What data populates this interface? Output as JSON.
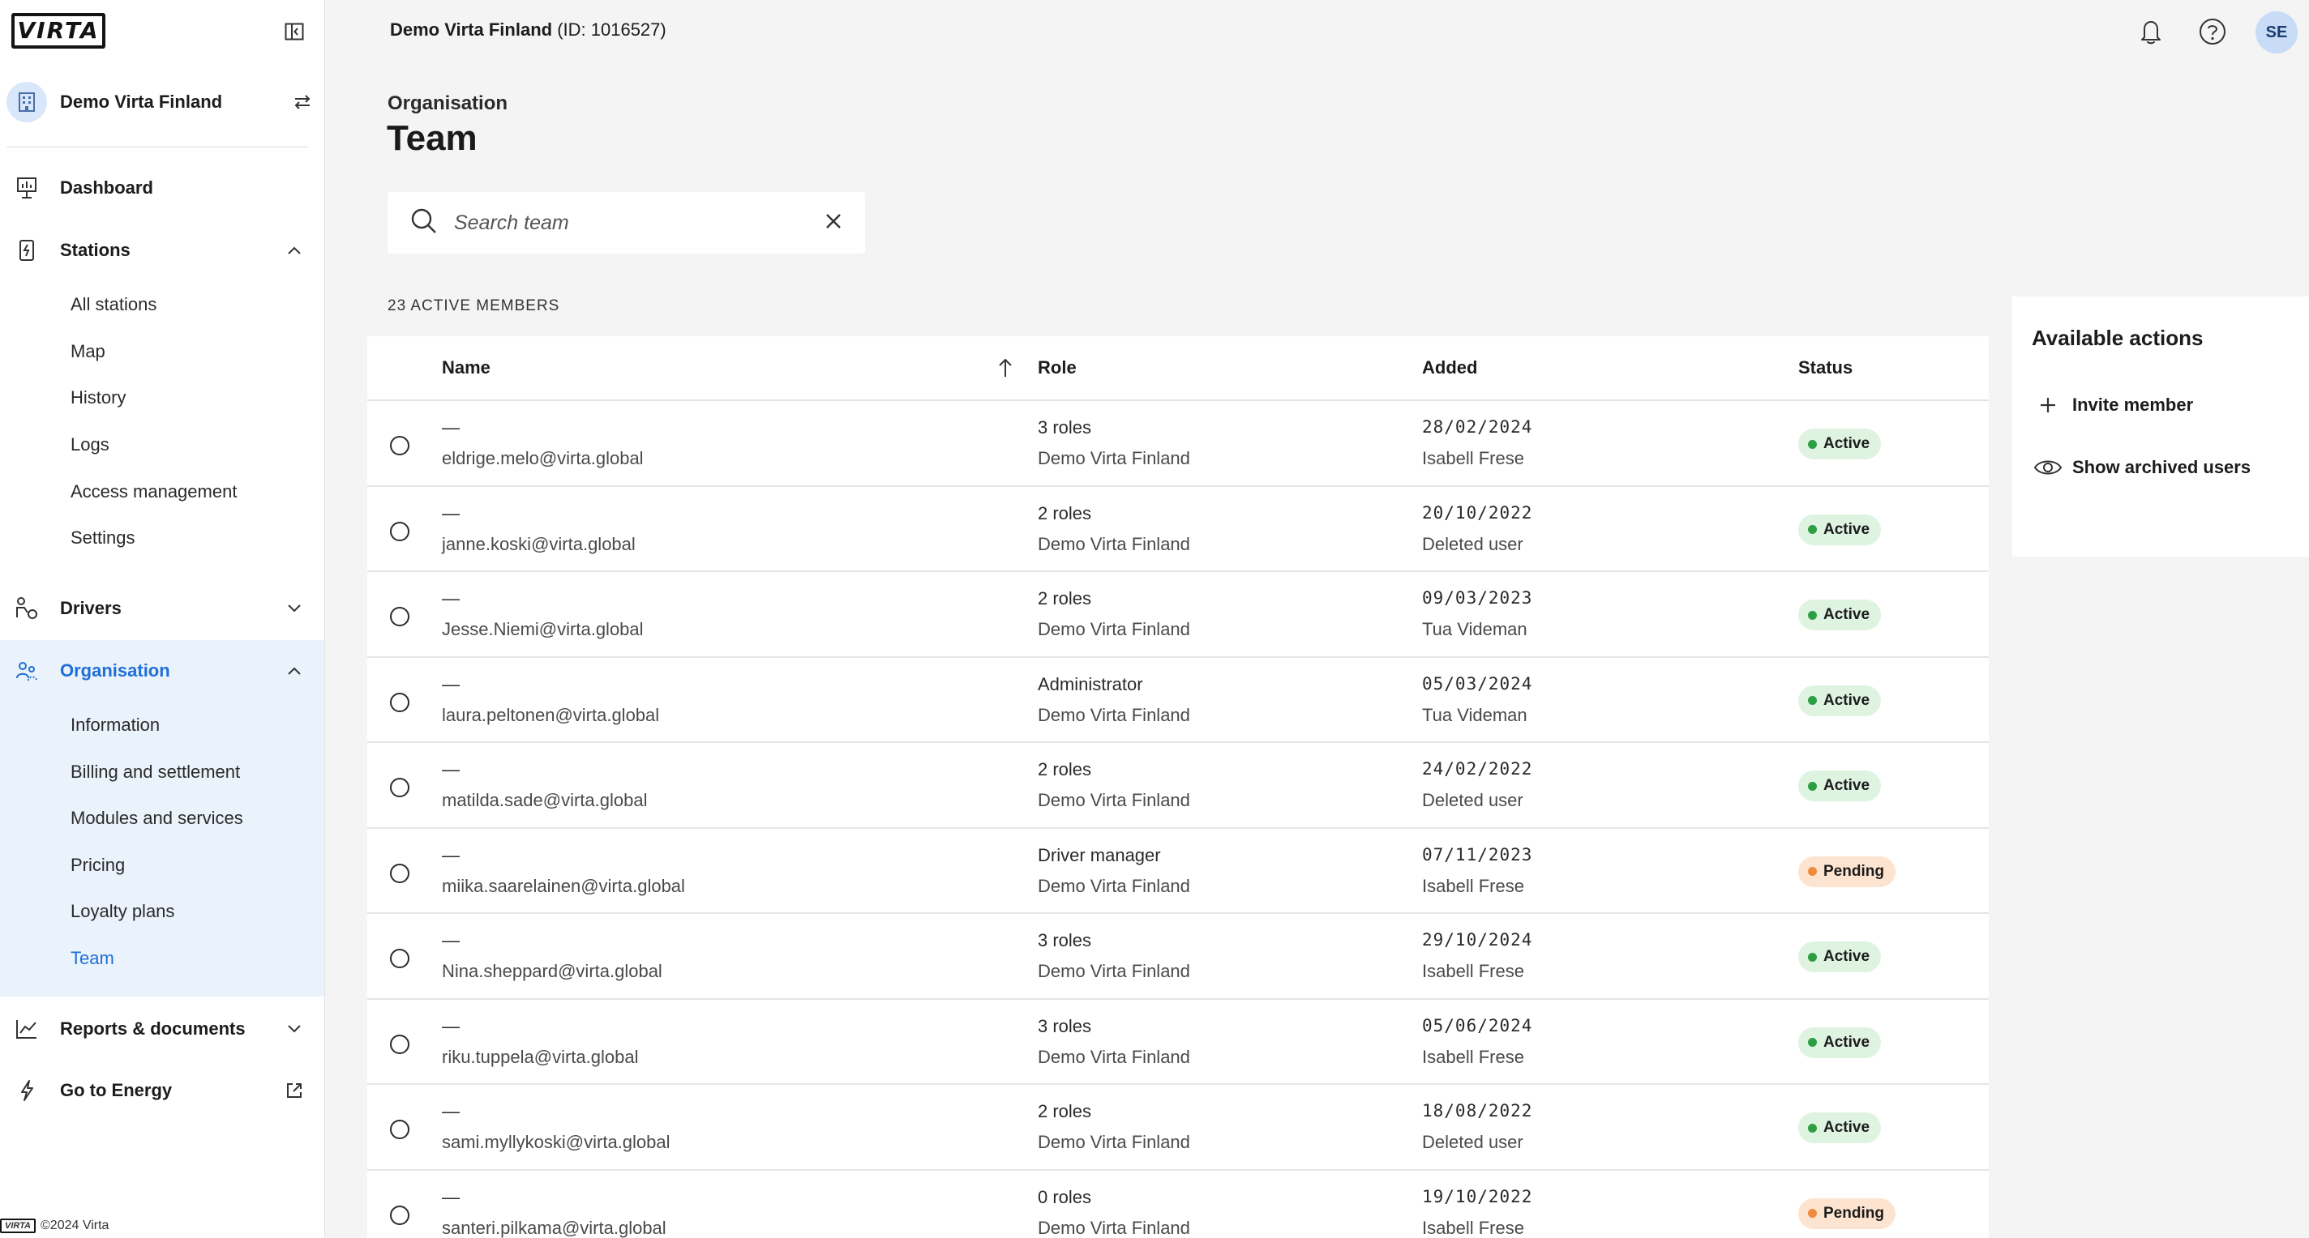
{
  "brand": {
    "logo_text": "VIRTA",
    "footer_logo_text": "VIRTA",
    "copyright": "©2024 Virta",
    "accent": "#1f6fd6"
  },
  "header": {
    "org_name": "Demo Virta Finland",
    "org_id": "(ID: 1016527)",
    "user_initials": "SE"
  },
  "sidebar": {
    "org_switcher": "Demo Virta Finland",
    "nav": {
      "dashboard": "Dashboard",
      "stations": "Stations",
      "stations_sub": [
        "All stations",
        "Map",
        "History",
        "Logs",
        "Access management",
        "Settings"
      ],
      "drivers": "Drivers",
      "organisation": "Organisation",
      "organisation_sub": [
        "Information",
        "Billing and settlement",
        "Modules and services",
        "Pricing",
        "Loyalty plans",
        "Team"
      ],
      "reports": "Reports & documents",
      "energy": "Go to Energy"
    }
  },
  "page": {
    "breadcrumb": "Organisation",
    "title": "Team",
    "search_placeholder": "Search team",
    "members_count": "23 ACTIVE MEMBERS"
  },
  "table": {
    "columns": {
      "name": "Name",
      "role": "Role",
      "added": "Added",
      "status": "Status"
    },
    "rows": [
      {
        "name": "—",
        "email": "eldrige.melo@virta.global",
        "role": "3 roles",
        "org": "Demo Virta Finland",
        "date": "28/02/2024",
        "added_by": "Isabell Frese",
        "status": "Active"
      },
      {
        "name": "—",
        "email": "janne.koski@virta.global",
        "role": "2 roles",
        "org": "Demo Virta Finland",
        "date": "20/10/2022",
        "added_by": "Deleted user",
        "status": "Active"
      },
      {
        "name": "—",
        "email": "Jesse.Niemi@virta.global",
        "role": "2 roles",
        "org": "Demo Virta Finland",
        "date": "09/03/2023",
        "added_by": "Tua Videman",
        "status": "Active"
      },
      {
        "name": "—",
        "email": "laura.peltonen@virta.global",
        "role": "Administrator",
        "org": "Demo Virta Finland",
        "date": "05/03/2024",
        "added_by": "Tua Videman",
        "status": "Active"
      },
      {
        "name": "—",
        "email": "matilda.sade@virta.global",
        "role": "2 roles",
        "org": "Demo Virta Finland",
        "date": "24/02/2022",
        "added_by": "Deleted user",
        "status": "Active"
      },
      {
        "name": "—",
        "email": "miika.saarelainen@virta.global",
        "role": "Driver manager",
        "org": "Demo Virta Finland",
        "date": "07/11/2023",
        "added_by": "Isabell Frese",
        "status": "Pending"
      },
      {
        "name": "—",
        "email": "Nina.sheppard@virta.global",
        "role": "3 roles",
        "org": "Demo Virta Finland",
        "date": "29/10/2024",
        "added_by": "Isabell Frese",
        "status": "Active"
      },
      {
        "name": "—",
        "email": "riku.tuppela@virta.global",
        "role": "3 roles",
        "org": "Demo Virta Finland",
        "date": "05/06/2024",
        "added_by": "Isabell Frese",
        "status": "Active"
      },
      {
        "name": "—",
        "email": "sami.myllykoski@virta.global",
        "role": "2 roles",
        "org": "Demo Virta Finland",
        "date": "18/08/2022",
        "added_by": "Deleted user",
        "status": "Active"
      },
      {
        "name": "—",
        "email": "santeri.pilkama@virta.global",
        "role": "0 roles",
        "org": "Demo Virta Finland",
        "date": "19/10/2022",
        "added_by": "Isabell Frese",
        "status": "Pending"
      }
    ]
  },
  "status_styles": {
    "Active": {
      "bg": "#dff3e1",
      "dot": "#2e9e44"
    },
    "Pending": {
      "bg": "#fde4d0",
      "dot": "#f08a3c"
    }
  },
  "actions": {
    "title": "Available actions",
    "invite": "Invite member",
    "archived": "Show archived users"
  }
}
